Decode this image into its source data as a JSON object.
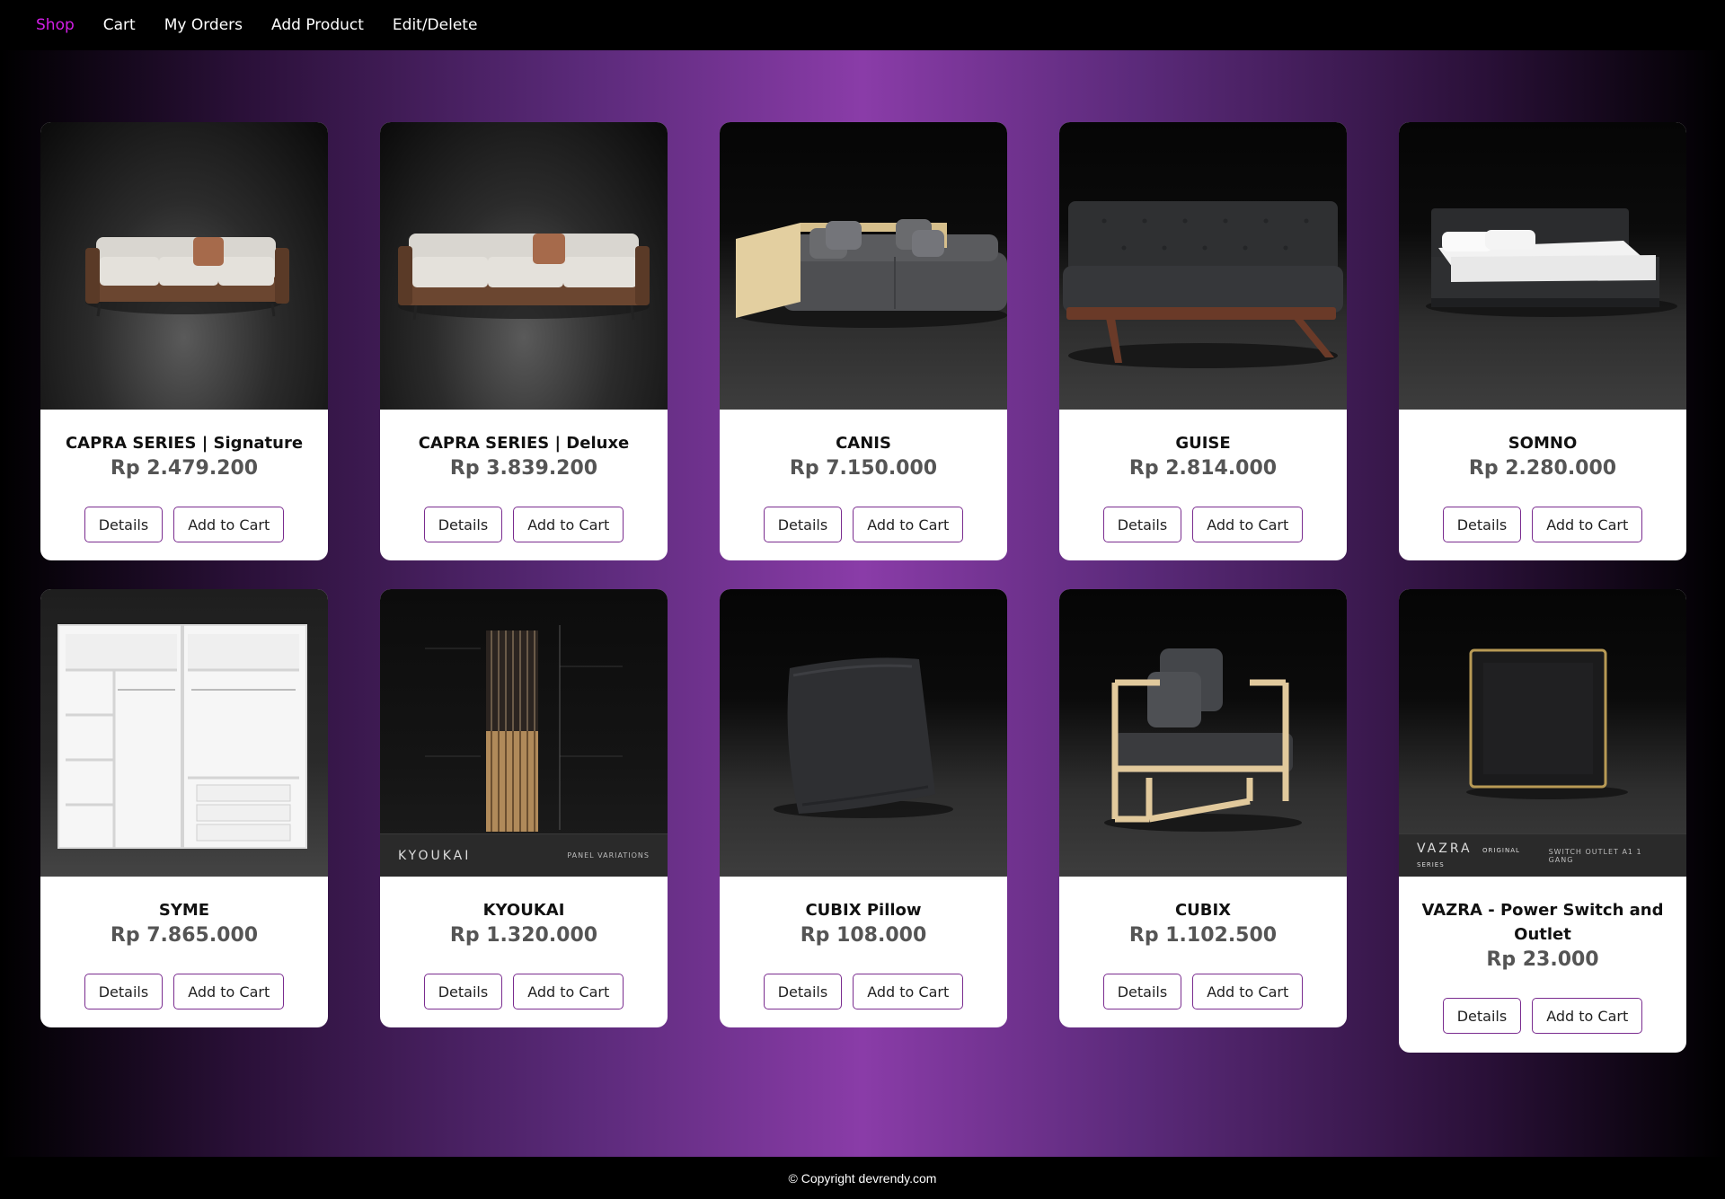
{
  "nav": {
    "items": [
      {
        "label": "Shop",
        "active": true
      },
      {
        "label": "Cart",
        "active": false
      },
      {
        "label": "My Orders",
        "active": false
      },
      {
        "label": "Add Product",
        "active": false
      },
      {
        "label": "Edit/Delete",
        "active": false
      }
    ]
  },
  "buttons": {
    "details_label": "Details",
    "add_to_cart_label": "Add to Cart"
  },
  "products": [
    {
      "name": "CAPRA SERIES | Signature",
      "price": "Rp 2.479.200",
      "image": "sofa-walnut-icon"
    },
    {
      "name": "CAPRA SERIES | Deluxe",
      "price": "Rp 3.839.200",
      "image": "sofa-walnut-long-icon"
    },
    {
      "name": "CANIS",
      "price": "Rp 7.150.000",
      "image": "sofa-gray-icon"
    },
    {
      "name": "GUISE",
      "price": "Rp 2.814.000",
      "image": "sofa-tufted-icon"
    },
    {
      "name": "SOMNO",
      "price": "Rp 2.280.000",
      "image": "bed-icon"
    },
    {
      "name": "SYME",
      "price": "Rp 7.865.000",
      "image": "wardrobe-icon"
    },
    {
      "name": "KYOUKAI",
      "price": "Rp 1.320.000",
      "image": "wall-panel-icon",
      "brand_left": "KYOUKAI",
      "brand_right": "PANEL VARIATIONS"
    },
    {
      "name": "CUBIX Pillow",
      "price": "Rp 108.000",
      "image": "pillow-icon"
    },
    {
      "name": "CUBIX",
      "price": "Rp 1.102.500",
      "image": "armchair-icon"
    },
    {
      "name": "VAZRA - Power Switch and Outlet",
      "price": "Rp 23.000",
      "image": "switch-plate-icon",
      "brand_left": "VAZRA",
      "brand_sub": "ORIGINAL SERIES",
      "brand_right": "SWITCH OUTLET A1 1 GANG"
    }
  ],
  "footer": {
    "copyright": "© Copyright devrendy.com"
  }
}
